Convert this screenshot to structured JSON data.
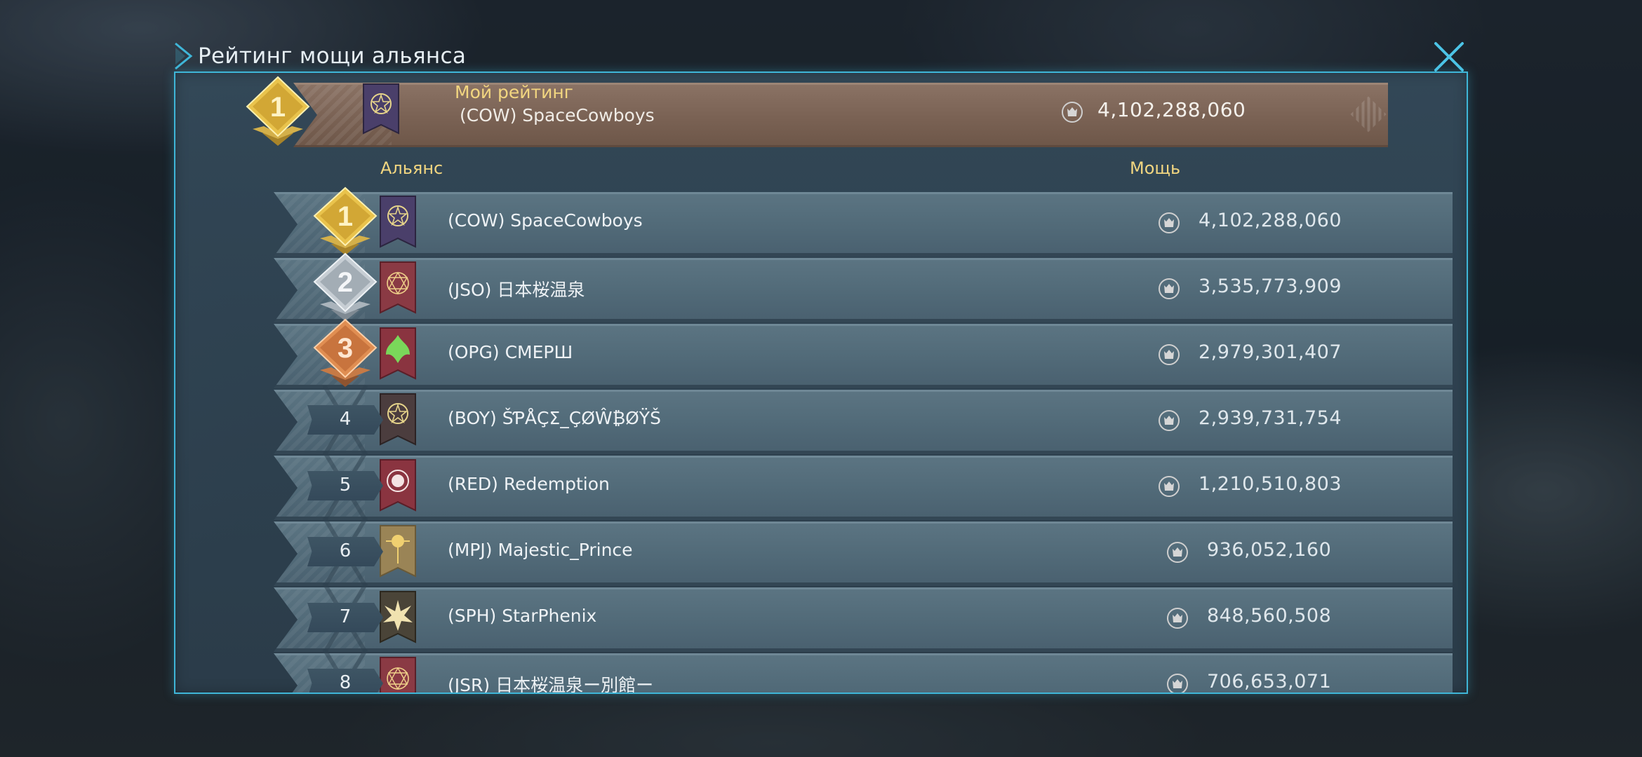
{
  "dialog": {
    "title": "Рейтинг мощи альянса",
    "accent_color": "#3fb6d8"
  },
  "my_rating": {
    "label": "Мой рейтинг",
    "rank": "1",
    "alliance": "(COW) SpaceCowboys",
    "power": "4,102,288,060"
  },
  "headers": {
    "alliance": "Альянс",
    "power": "Мощь"
  },
  "rows": [
    {
      "rank": "1",
      "medal": "gold",
      "flag": "star-emblem-purple",
      "name": "(COW) SpaceCowboys",
      "power": "4,102,288,060"
    },
    {
      "rank": "2",
      "medal": "silver",
      "flag": "web-emblem-red",
      "name": "(JSO) 日本桜温泉",
      "power": "3,535,773,909"
    },
    {
      "rank": "3",
      "medal": "bronze",
      "flag": "leaf-emblem-red",
      "name": "(OPG) СМЕРШ",
      "power": "2,979,301,407"
    },
    {
      "rank": "4",
      "medal": "none",
      "flag": "star-emblem-brown",
      "name": "(BOY) ŠƤÅÇΣ_ÇØŴ₿ØŸŠ",
      "power": "2,939,731,754"
    },
    {
      "rank": "5",
      "medal": "none",
      "flag": "circle-emblem-red",
      "name": "(RED) Redemption",
      "power": "1,210,510,803"
    },
    {
      "rank": "6",
      "medal": "none",
      "flag": "orb-emblem-tan",
      "name": "(MPJ) Majestic_Prince",
      "power": "936,052,160"
    },
    {
      "rank": "7",
      "medal": "none",
      "flag": "wing-emblem-dark",
      "name": "(SPH) StarPhenix",
      "power": "848,560,508"
    },
    {
      "rank": "8",
      "medal": "none",
      "flag": "web-emblem-red",
      "name": "(JSR) 日本桜温泉ー別館ー",
      "power": "706,653,071"
    }
  ],
  "icons": {
    "power": "crown-power-icon",
    "close": "close-icon",
    "title_chevron": "chevron-right-icon"
  }
}
